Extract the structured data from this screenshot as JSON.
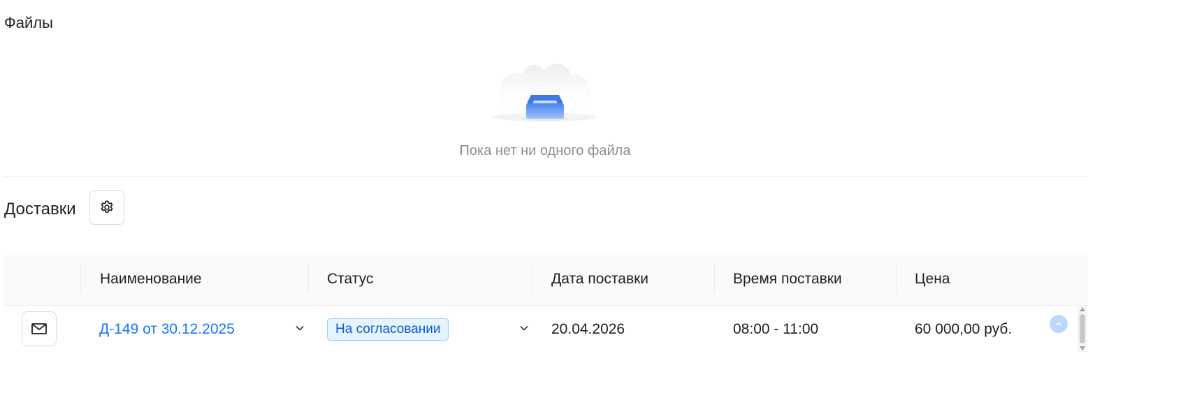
{
  "files": {
    "title": "Файлы",
    "empty_text": "Пока нет ни одного файла"
  },
  "deliveries": {
    "title": "Доставки",
    "settings_icon": "gear-icon",
    "table": {
      "columns": [
        "",
        "Наименование",
        "Статус",
        "Дата поставки",
        "Время поставки",
        "Цена"
      ],
      "rows": [
        {
          "action_icon": "mail-icon",
          "name": "Д-149 от 30.12.2025",
          "status": "На согласовании",
          "delivery_date": "20.04.2026",
          "delivery_time": "08:00 - 11:00",
          "price": "60 000,00 руб."
        }
      ]
    }
  },
  "colors": {
    "link": "#1677ff",
    "status_bg": "#e6f4ff",
    "status_border": "#91caff",
    "status_text": "#0958d9",
    "header_bg": "#fafafa"
  }
}
